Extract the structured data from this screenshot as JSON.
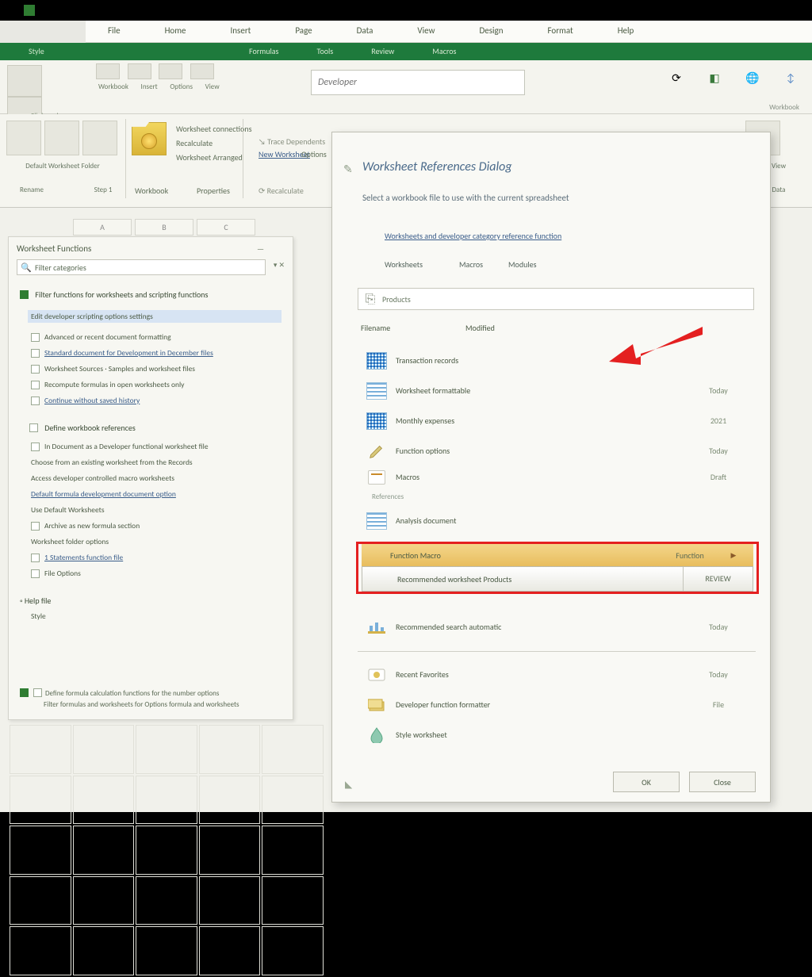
{
  "colors": {
    "accent": "#1e7a3c",
    "highlight": "#e42020",
    "link": "#3a5d8a"
  },
  "menubar": {
    "items": [
      "File",
      "Home",
      "Insert",
      "Page",
      "Data",
      "View",
      "Design",
      "Format",
      "Help"
    ]
  },
  "ribbonTabs": {
    "label": "Style",
    "items": [
      "Formulas",
      "Tools",
      "Review",
      "Macros"
    ]
  },
  "ribbon": {
    "groups": {
      "clipboard": {
        "label": "Clipboard"
      },
      "workbook": {
        "label": "Workbook",
        "items": [
          "Workbook",
          "Insert",
          "Options",
          "View"
        ]
      }
    },
    "search": {
      "placeholder": "Developer"
    },
    "right": {
      "label": "Workbook"
    }
  },
  "ribbon2": {
    "left": {
      "a": "Default Worksheet Folder",
      "b": "Rename",
      "c": "Step 1"
    },
    "midTop": "Worksheet connections",
    "midItems": [
      "Recalculate",
      "Worksheet  Arranged",
      "Trace Dependents"
    ],
    "link": {
      "a": "New Worksheet",
      "b": "Options"
    },
    "commands": {
      "a": "Workbook",
      "b": "Properties"
    },
    "recalc": "Recalculate",
    "rightLabels": [
      "View",
      "Data"
    ]
  },
  "columns": [
    "A",
    "B",
    "C"
  ],
  "taskPane": {
    "title": "Worksheet Functions",
    "dropdown": "Filter categories",
    "sectionA": {
      "heading": "Filter functions for worksheets and scripting functions",
      "items": [
        {
          "text": "Edit developer scripting options settings",
          "selected": true
        },
        {
          "text": "Advanced or recent document formatting"
        },
        {
          "text": "Standard document for Development in December files",
          "link": true
        },
        {
          "text": "Worksheet Sources · Samples and worksheet files"
        },
        {
          "text": "Recompute formulas in open worksheets only"
        },
        {
          "text": "Continue without saved history",
          "link": true
        }
      ]
    },
    "sectionB": {
      "heading": "Define workbook references",
      "items": [
        {
          "text": "In Document as a Developer functional worksheet file"
        },
        {
          "text": "Choose from an existing worksheet from the Records"
        },
        {
          "text": "Access developer controlled macro worksheets"
        },
        {
          "text": "Default formula development document option",
          "link": true
        },
        {
          "text": "Use Default Worksheets"
        },
        {
          "text": "Archive as new formula section"
        },
        {
          "text": "Worksheet folder options"
        },
        {
          "text": "1 Statements function file",
          "link": true
        },
        {
          "text": "File Options"
        }
      ]
    },
    "help": {
      "label": "Help file",
      "sub": "Style"
    },
    "footer": {
      "line1": "Define formula calculation functions for the number options",
      "line2": "Filter formulas and worksheets for Options formula and worksheets"
    }
  },
  "dialog": {
    "title": "Worksheet References Dialog",
    "subtitle": "Select a workbook file to use with the current spreadsheet",
    "topLink": "Worksheets and developer category reference function",
    "tabs": [
      "Worksheets",
      "Macros",
      "Modules"
    ],
    "search": "Products",
    "col1": "Filename",
    "col2": "Modified",
    "list": [
      {
        "name": "Transaction records",
        "mod": ""
      },
      {
        "name": "Worksheet formattable",
        "mod": "Today"
      },
      {
        "name": "Monthly expenses",
        "mod": "2021"
      },
      {
        "name": "Function options",
        "mod": "Today"
      },
      {
        "name": "Macros",
        "sub": "References",
        "mod": "Draft"
      },
      {
        "name": "Analysis document",
        "mod": ""
      }
    ],
    "highlight": {
      "row1": {
        "name": "Function Macro",
        "mod": "Function",
        "arrow": "▶"
      },
      "row2": {
        "name": "Recommended worksheet Products",
        "mod": "REVIEW"
      }
    },
    "below": [
      {
        "name": "Recommended search automatic",
        "mod": "Today"
      }
    ],
    "below2": [
      {
        "name": "Recent Favorites",
        "mod": "Today"
      },
      {
        "name": "Developer function formatter",
        "mod": "File"
      },
      {
        "name": "Style worksheet",
        "mod": ""
      }
    ],
    "buttons": {
      "ok": "OK",
      "cancel": "Close"
    }
  }
}
